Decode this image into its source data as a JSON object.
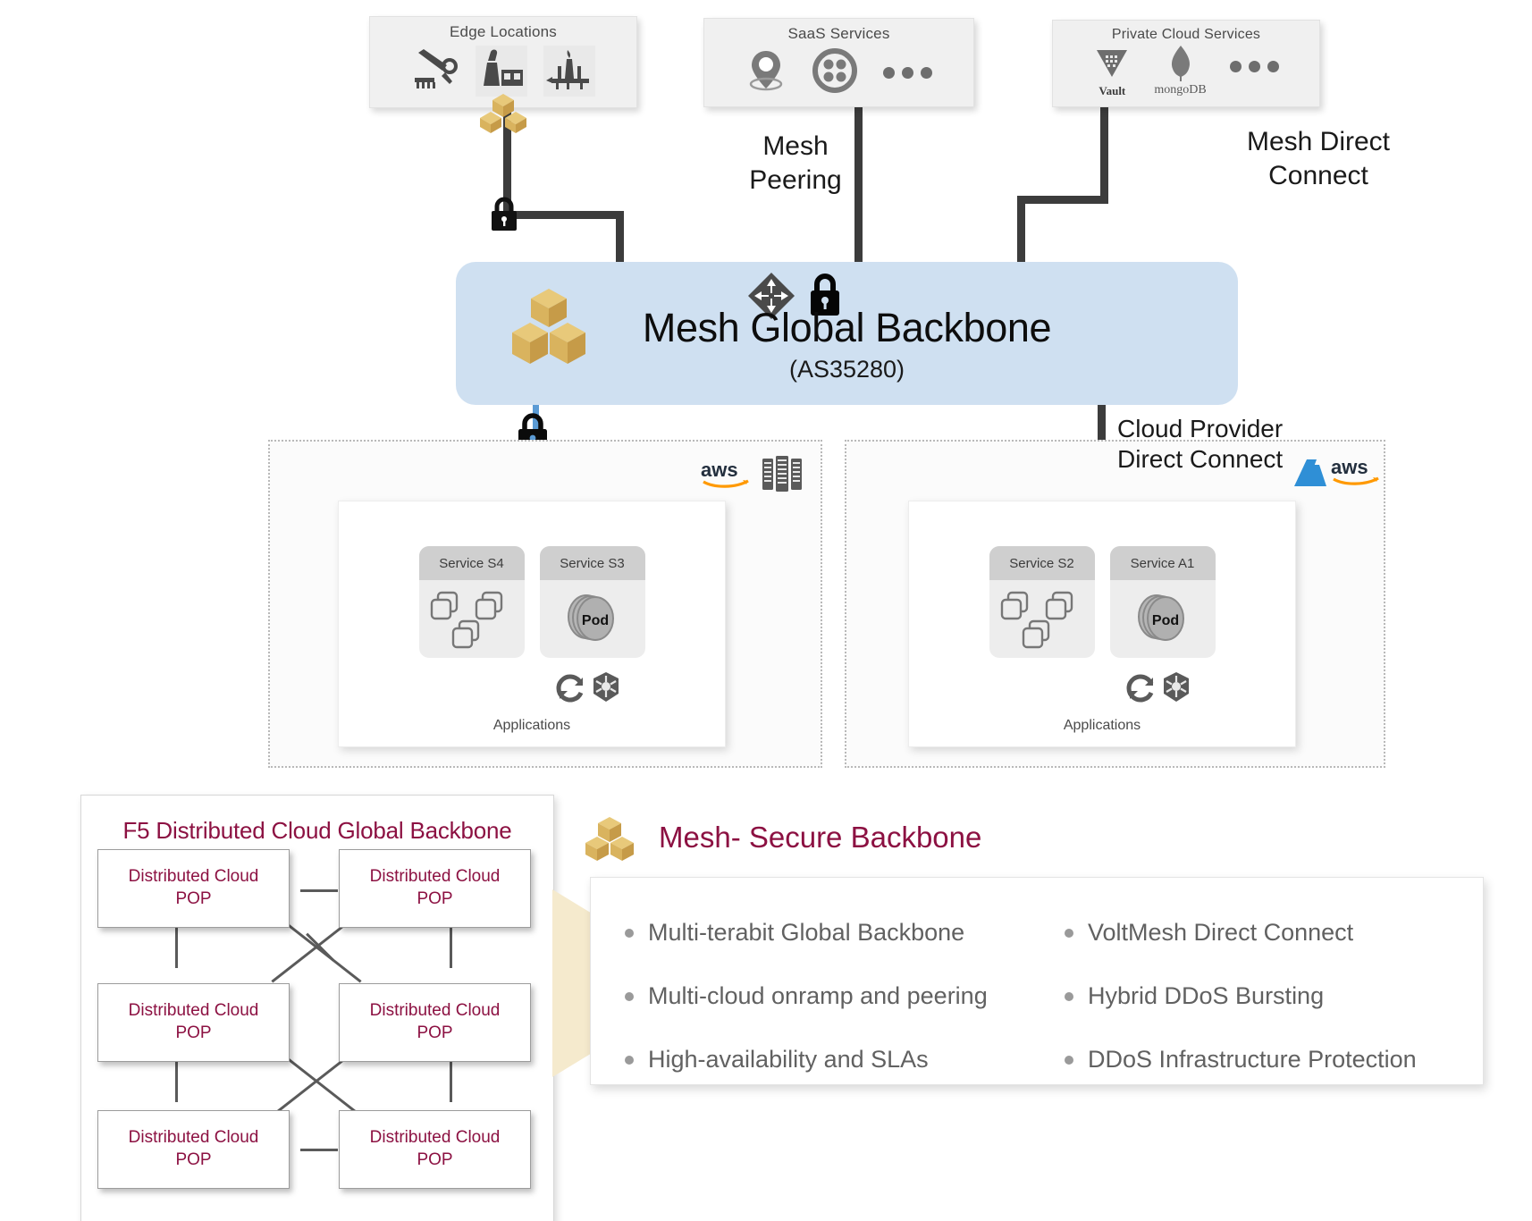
{
  "top_boxes": [
    {
      "title": "Edge Locations",
      "icons": [
        "robot-arm-icon",
        "factory-icon",
        "oil-rig-icon"
      ]
    },
    {
      "title": "SaaS Services",
      "icons": [
        "location-pin-icon",
        "circle-quad-dots-icon",
        "ellipsis-icon"
      ]
    },
    {
      "title": "Private Cloud Services",
      "icons": [
        "vault-icon",
        "mongodb-icon",
        "ellipsis-icon"
      ],
      "icon_labels": [
        "Vault",
        "mongoDB"
      ]
    }
  ],
  "connector_labels": {
    "mesh_peering": "Mesh\nPeering",
    "mesh_peering_line1": "Mesh",
    "mesh_peering_line2": "Peering",
    "mesh_direct_connect_line1": "Mesh Direct",
    "mesh_direct_connect_line2": "Connect",
    "cloud_provider_line1": "Cloud Provider",
    "cloud_provider_line2": "Direct Connect"
  },
  "backbone": {
    "title": "Mesh Global Backbone",
    "subtitle": "(AS35280)",
    "bg_color": "#cfe0f1",
    "icons": [
      "router-icon",
      "lock-icon",
      "mesh-cubes-icon"
    ]
  },
  "cloud_regions": [
    {
      "provider_logos": [
        "aws-logo",
        "servers-icon"
      ],
      "card_title": "Applications",
      "services": [
        {
          "name": "Service S4",
          "type": "containers"
        },
        {
          "name": "Service S3",
          "type": "pod",
          "pod_label": "Pod"
        }
      ],
      "footer_icons": [
        "sync-icon",
        "kubernetes-icon"
      ]
    },
    {
      "provider_logos": [
        "azure-logo",
        "aws-logo"
      ],
      "card_title": "Applications",
      "services": [
        {
          "name": "Service S2",
          "type": "containers"
        },
        {
          "name": "Service A1",
          "type": "pod",
          "pod_label": "Pod"
        }
      ],
      "footer_icons": [
        "sync-icon",
        "kubernetes-icon"
      ]
    }
  ],
  "f5_panel": {
    "title": "F5 Distributed Cloud Global Backbone",
    "accent_color": "#8c1142",
    "pops": [
      "Distributed Cloud\nPOP",
      "Distributed Cloud\nPOP",
      "Distributed Cloud\nPOP",
      "Distributed Cloud\nPOP",
      "Distributed Cloud\nPOP",
      "Distributed Cloud\nPOP"
    ],
    "pop_line1": "Distributed Cloud",
    "pop_line2": "POP"
  },
  "feature_panel": {
    "title": "Mesh- Secure Backbone",
    "accent_color": "#8c1142",
    "icon": "mesh-cubes-icon",
    "bullets_left": [
      "Multi-terabit Global Backbone",
      "Multi-cloud onramp and peering",
      "High-availability and SLAs"
    ],
    "bullets_right": [
      "VoltMesh Direct Connect",
      "Hybrid DDoS Bursting",
      "DDoS Infrastructure Protection"
    ]
  }
}
